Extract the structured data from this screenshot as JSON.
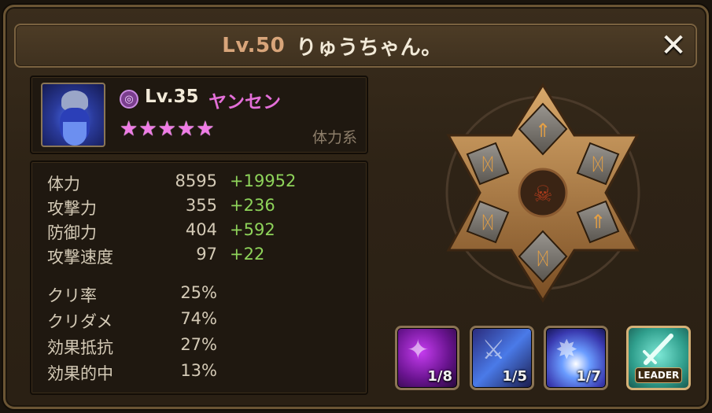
{
  "header": {
    "level": "Lv.50",
    "name": "りゅうちゃん。",
    "close_icon": "close-icon"
  },
  "monster": {
    "level": "Lv.35",
    "name": "ヤンセン",
    "stars": 5,
    "element_icon": "dark-element-icon",
    "type": "体力系"
  },
  "stats": [
    {
      "label": "体力",
      "base": "8595",
      "bonus": "+19952"
    },
    {
      "label": "攻撃力",
      "base": "355",
      "bonus": "+236"
    },
    {
      "label": "防御力",
      "base": "404",
      "bonus": "+592"
    },
    {
      "label": "攻撃速度",
      "base": "97",
      "bonus": "+22"
    }
  ],
  "secondary_stats": [
    {
      "label": "クリ率",
      "value": "25%"
    },
    {
      "label": "クリダメ",
      "value": "74%"
    },
    {
      "label": "効果抵抗",
      "value": "27%"
    },
    {
      "label": "効果的中",
      "value": "13%"
    }
  ],
  "skills": [
    {
      "level": "1/8",
      "icon": "purple-slash-skill-icon"
    },
    {
      "level": "1/5",
      "icon": "blue-warrior-skill-icon"
    },
    {
      "level": "1/7",
      "icon": "blue-burst-skill-icon"
    }
  ],
  "leader": {
    "label": "LEADER",
    "icon": "leader-sword-icon"
  },
  "colors": {
    "accent_pink": "#e36fd8",
    "bonus_green": "#8ed35a",
    "level_orange": "#d8a57a"
  }
}
